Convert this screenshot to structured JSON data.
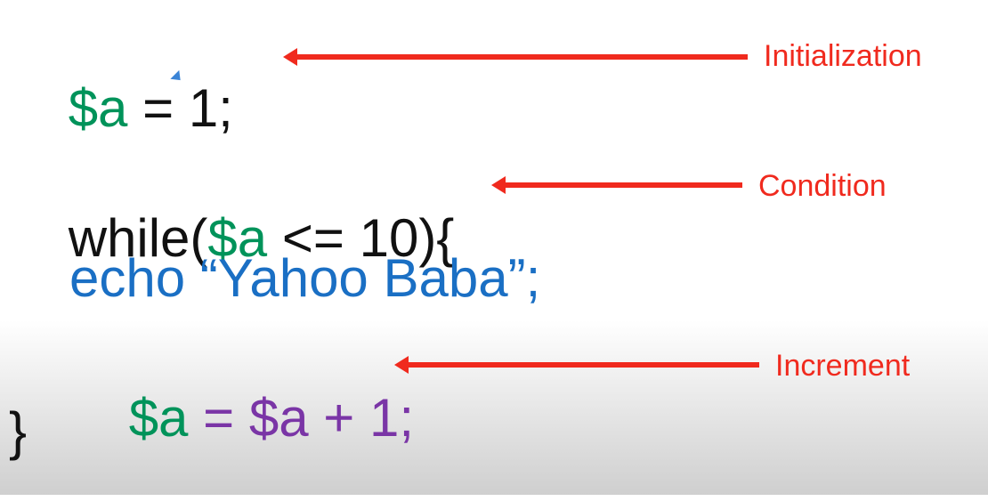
{
  "code": {
    "line1": {
      "var": "$a",
      "rest": " = 1;"
    },
    "line2": {
      "prefix": "while(",
      "var": "$a",
      "rest": " <= 10){"
    },
    "line3": {
      "text": "echo “Yahoo Baba”;"
    },
    "line4": {
      "var": "$a",
      "op": " = ",
      "expr": "$a + 1;"
    },
    "line5": {
      "text": "}"
    }
  },
  "annotations": {
    "initialization": "Initialization",
    "condition": "Condition",
    "increment": "Increment"
  },
  "colors": {
    "arrow": "#f02a1e",
    "variable": "#00935a",
    "echo": "#1a6fc4",
    "expression": "#7a35a6",
    "code": "#111111"
  },
  "icons": [
    "mouse-cursor-icon"
  ]
}
